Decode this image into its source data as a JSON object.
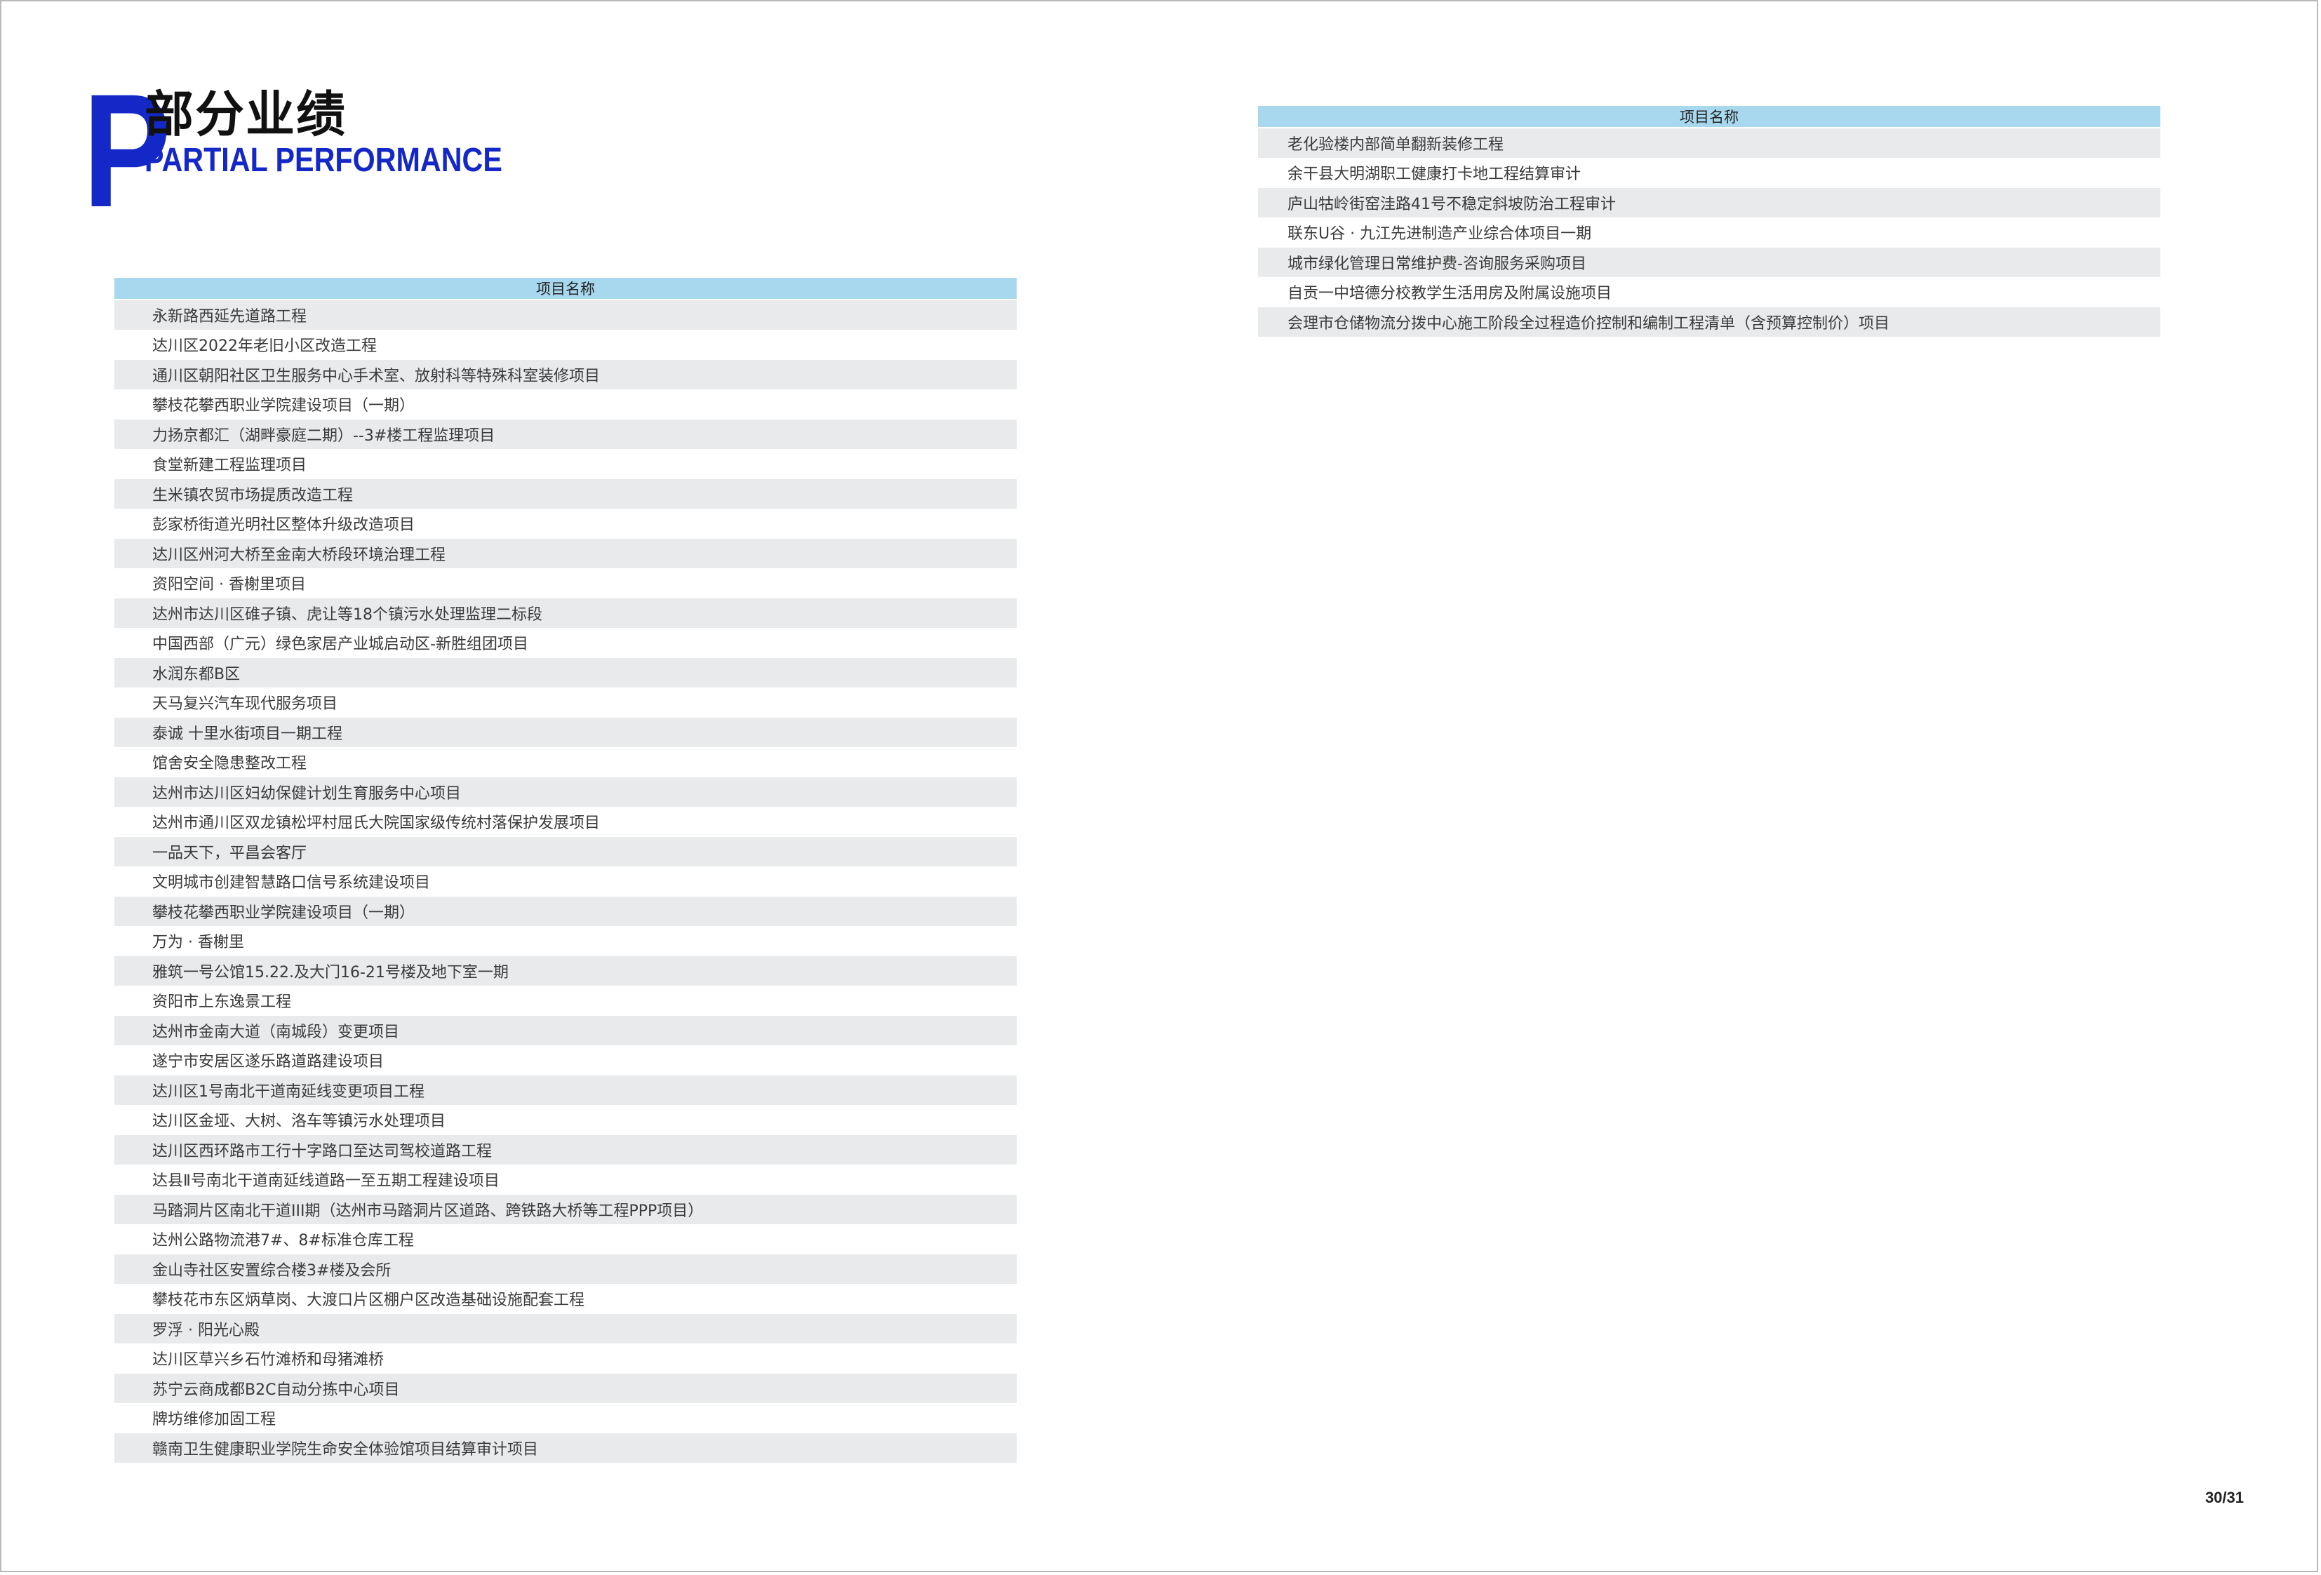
{
  "header": {
    "letter": "P",
    "title_cn": "部分业绩",
    "title_en": "PARTIAL PERFORMANCE"
  },
  "table_left": {
    "header": "项目名称",
    "rows": [
      "永新路西延先道路工程",
      "达川区2022年老旧小区改造工程",
      "通川区朝阳社区卫生服务中心手术室、放射科等特殊科室装修项目",
      "攀枝花攀西职业学院建设项目（一期）",
      "力扬京都汇（湖畔豪庭二期）--3#楼工程监理项目",
      "食堂新建工程监理项目",
      "生米镇农贸市场提质改造工程",
      "彭家桥街道光明社区整体升级改造项目",
      "达川区州河大桥至金南大桥段环境治理工程",
      "资阳空间 · 香榭里项目",
      "达州市达川区碓子镇、虎让等18个镇污水处理监理二标段",
      "中国西部（广元）绿色家居产业城启动区-新胜组团项目",
      "水润东都B区",
      "天马复兴汽车现代服务项目",
      "泰诚 十里水街项目一期工程",
      "馆舍安全隐患整改工程",
      "达州市达川区妇幼保健计划生育服务中心项目",
      "达州市通川区双龙镇松坪村屈氏大院国家级传统村落保护发展项目",
      "一品天下，平昌会客厅",
      "文明城市创建智慧路口信号系统建设项目",
      "攀枝花攀西职业学院建设项目（一期）",
      "万为 · 香榭里",
      "雅筑一号公馆15.22.及大门16-21号楼及地下室一期",
      "资阳市上东逸景工程",
      "达州市金南大道（南城段）变更项目",
      "遂宁市安居区遂乐路道路建设项目",
      "达川区1号南北干道南延线变更项目工程",
      "达川区金垭、大树、洛车等镇污水处理项目",
      "达川区西环路市工行十字路口至达司驾校道路工程",
      "达县Ⅱ号南北干道南延线道路一至五期工程建设项目",
      "马踏洞片区南北干道III期（达州市马踏洞片区道路、跨铁路大桥等工程PPP项目）",
      "达州公路物流港7#、8#标准仓库工程",
      "金山寺社区安置综合楼3#楼及会所",
      "攀枝花市东区炳草岗、大渡口片区棚户区改造基础设施配套工程",
      "罗浮 · 阳光心殿",
      "达川区草兴乡石竹滩桥和母猪滩桥",
      "苏宁云商成都B2C自动分拣中心项目",
      "牌坊维修加固工程",
      "赣南卫生健康职业学院生命安全体验馆项目结算审计项目"
    ]
  },
  "table_right": {
    "header": "项目名称",
    "rows": [
      "老化验楼内部简单翻新装修工程",
      "余干县大明湖职工健康打卡地工程结算审计",
      "庐山牯岭街窑洼路41号不稳定斜坡防治工程审计",
      "联东U谷 · 九江先进制造产业综合体项目一期",
      "城市绿化管理日常维护费-咨询服务采购项目",
      "自贡一中培德分校教学生活用房及附属设施项目",
      "会理市仓储物流分拨中心施工阶段全过程造价控制和编制工程清单（含预算控制价）项目"
    ]
  },
  "footer": {
    "page_number": "30/31"
  },
  "colors": {
    "brand_blue": "#1428c8",
    "table_header_bg": "#a8d8ee",
    "row_stripe": "#e8eaeb"
  }
}
